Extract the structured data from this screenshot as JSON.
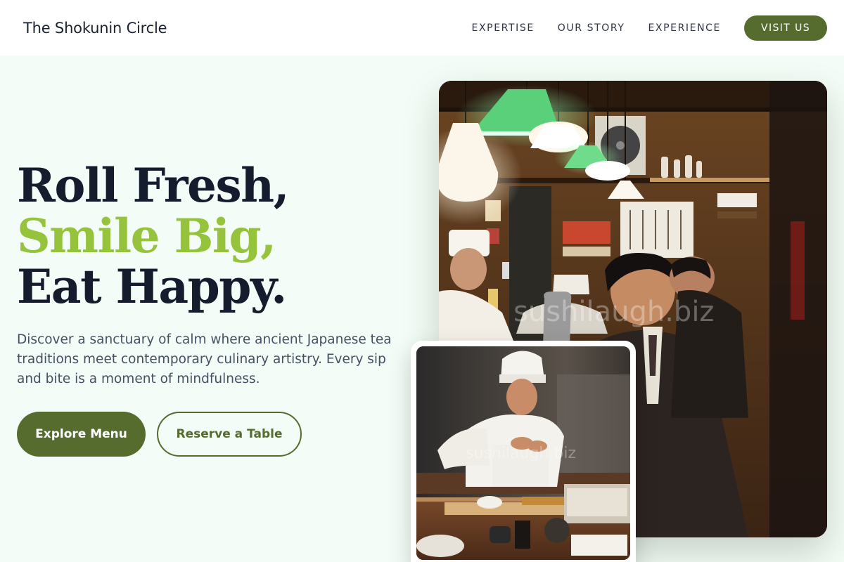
{
  "header": {
    "brand": "The Shokunin Circle",
    "nav": [
      {
        "label": "EXPERTISE"
      },
      {
        "label": "OUR STORY"
      },
      {
        "label": "EXPERIENCE"
      }
    ],
    "cta_label": "VISIT US"
  },
  "hero": {
    "headline_line1": "Roll Fresh,",
    "headline_line2": "Smile Big,",
    "headline_line3": "Eat Happy.",
    "description": "Discover a sanctuary of calm where ancient Japanese tea traditions meet contemporary culinary artistry. Every sip and bite is a moment of mindfulness.",
    "primary_button": "Explore Menu",
    "secondary_button": "Reserve a Table"
  },
  "images": {
    "main_watermark": "sushilaugh.biz",
    "small_watermark": "sushilaugh.biz"
  },
  "colors": {
    "brand_green": "#566b2e",
    "accent_lime": "#95c43c",
    "headline_navy": "#141c2d",
    "page_background": "#f3fcf6"
  }
}
